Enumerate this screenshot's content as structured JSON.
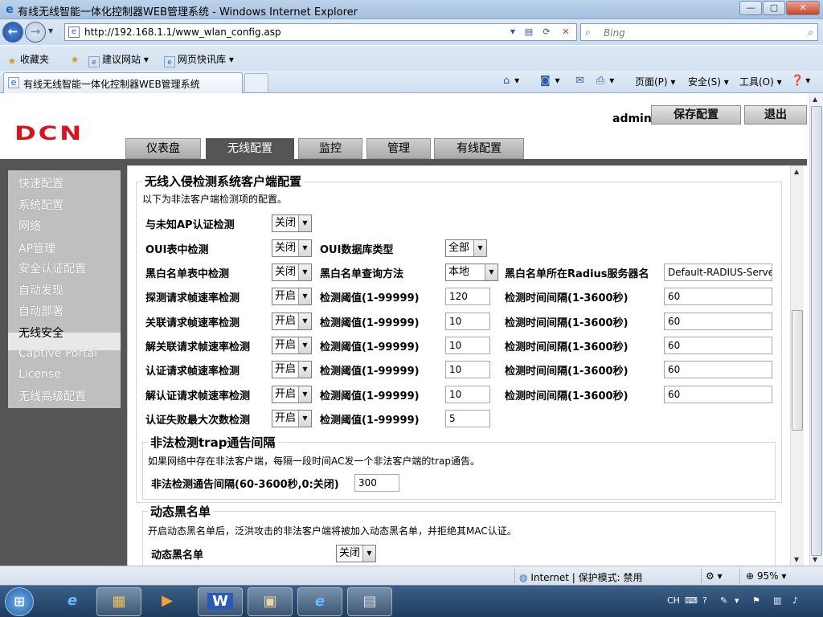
{
  "window": {
    "title": "有线无线智能一体化控制器WEB管理系统 - Windows Internet Explorer",
    "minimize_glyph": "—",
    "maximize_glyph": "▢",
    "close_glyph": "✕"
  },
  "address": {
    "url": "http://192.168.1.1/www_wlan_config.asp",
    "search_placeholder": "Bing"
  },
  "favorites": {
    "label": "收藏夹",
    "items": [
      "建议网站 ▾",
      "网页快讯库 ▾"
    ]
  },
  "tab": {
    "title": "有线无线智能一体化控制器WEB管理系统"
  },
  "commands": {
    "page": "页面(P) ▾",
    "safety": "安全(S) ▾",
    "tools": "工具(O) ▾"
  },
  "header": {
    "logo": "DCN",
    "admin": "admin",
    "save_config": "保存配置",
    "logout": "退出"
  },
  "nav_tabs": [
    "仪表盘",
    "无线配置",
    "监控",
    "管理",
    "有线配置"
  ],
  "sidebar": {
    "items": [
      "快速配置",
      "系统配置",
      "网络",
      "AP管理",
      "安全认证配置",
      "自动发现",
      "自动部署",
      "无线安全",
      "Captive Portal",
      "License",
      "无线高级配置"
    ],
    "active_index": 7
  },
  "ids_section": {
    "legend": "无线入侵检测系统客户端配置",
    "description": "以下为非法客户端检测项的配置。",
    "rows": [
      {
        "label": "与未知AP认证检测",
        "state": "关闭"
      },
      {
        "label": "OUI表中检测",
        "state": "关闭",
        "label2": "OUI数据库类型",
        "select2": "全部"
      },
      {
        "label": "黑白名单表中检测",
        "state": "关闭",
        "label2": "黑白名单查询方法",
        "select2": "本地",
        "label3": "黑白名单所在Radius服务器名",
        "value3": "Default-RADIUS-Server"
      },
      {
        "label": "探测请求帧速率检测",
        "state": "开启",
        "label2": "检测阈值(1-99999)",
        "value2": "120",
        "label3": "检测时间间隔(1-3600秒)",
        "value3": "60"
      },
      {
        "label": "关联请求帧速率检测",
        "state": "开启",
        "label2": "检测阈值(1-99999)",
        "value2": "10",
        "label3": "检测时间间隔(1-3600秒)",
        "value3": "60"
      },
      {
        "label": "解关联请求帧速率检测",
        "state": "开启",
        "label2": "检测阈值(1-99999)",
        "value2": "10",
        "label3": "检测时间间隔(1-3600秒)",
        "value3": "60"
      },
      {
        "label": "认证请求帧速率检测",
        "state": "开启",
        "label2": "检测阈值(1-99999)",
        "value2": "10",
        "label3": "检测时间间隔(1-3600秒)",
        "value3": "60"
      },
      {
        "label": "解认证请求帧速率检测",
        "state": "开启",
        "label2": "检测阈值(1-99999)",
        "value2": "10",
        "label3": "检测时间间隔(1-3600秒)",
        "value3": "60"
      },
      {
        "label": "认证失败最大次数检测",
        "state": "开启",
        "label2": "检测阈值(1-99999)",
        "value2": "5"
      }
    ]
  },
  "trap_section": {
    "legend": "非法检测trap通告间隔",
    "description": "如果网络中存在非法客户端，每隔一段时间AC发一个非法客户端的trap通告。",
    "label": "非法检测通告间隔(60-3600秒,0:关闭)",
    "value": "300"
  },
  "blacklist_section": {
    "legend": "动态黑名单",
    "description": "开启动态黑名单后，泛洪攻击的非法客户端将被加入动态黑名单，并拒绝其MAC认证。",
    "label": "动态黑名单",
    "state": "关闭"
  },
  "statusbar": {
    "zone": "Internet | 保护模式: 禁用",
    "zoom": "95%"
  },
  "taskbar": {
    "ime": "CH"
  }
}
